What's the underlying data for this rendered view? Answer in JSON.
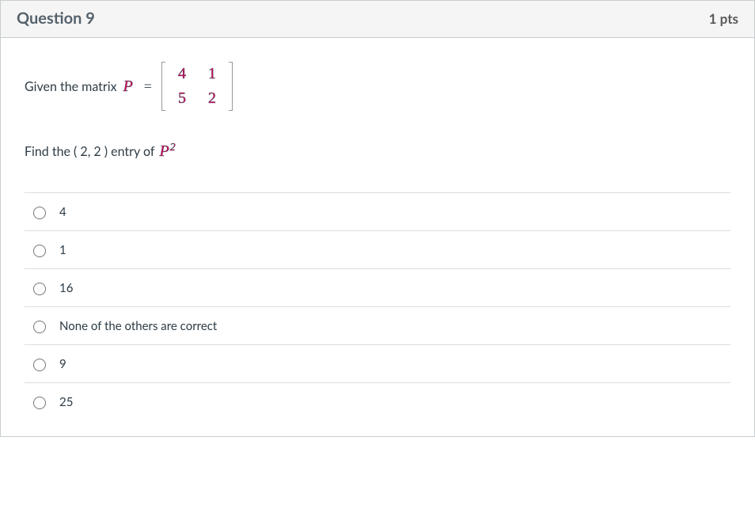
{
  "header": {
    "title": "Question 9",
    "points": "1 pts"
  },
  "prompt": {
    "given_text": "Given the matrix ",
    "var_P": "P",
    "equals": " = ",
    "matrix": {
      "rows": [
        [
          "4",
          "1"
        ],
        [
          "5",
          "2"
        ]
      ]
    },
    "find_prefix": "Find the ( 2, 2 ) entry of ",
    "var_P2": "P",
    "var_P2_sup": "2"
  },
  "answers": [
    {
      "label": "4"
    },
    {
      "label": "1"
    },
    {
      "label": "16"
    },
    {
      "label": "None of the others are correct"
    },
    {
      "label": "9"
    },
    {
      "label": "25"
    }
  ]
}
